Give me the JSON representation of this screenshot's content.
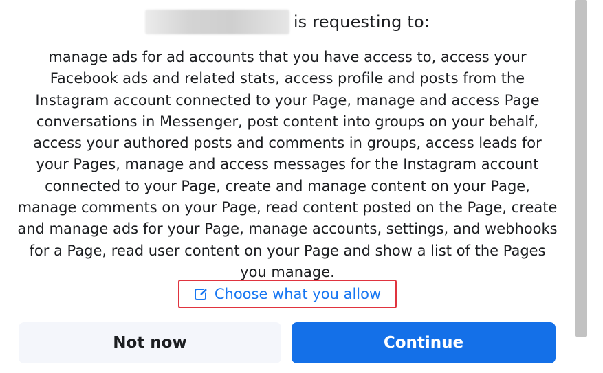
{
  "dialog": {
    "app_name": "",
    "header_text": "is requesting to:",
    "permissions_text": "manage ads for ad accounts that you have access to, access your Facebook ads and related stats, access profile and posts from the Instagram account connected to your Page, manage and access Page conversations in Messenger, post content into groups on your behalf, access your authored posts and comments in groups, access leads for your Pages, manage and access messages for the Instagram account connected to your Page, create and manage content on your Page, manage comments on your Page, read content posted on the Page, create and manage ads for your Page, manage accounts, settings, and webhooks for a Page, read user content on your Page and show a list of the Pages you manage.",
    "choose_link": {
      "label": "Choose what you allow",
      "icon": "edit-icon",
      "highlight_color": "#e0343f"
    },
    "buttons": {
      "not_now": "Not now",
      "continue": "Continue"
    }
  },
  "colors": {
    "link": "#1877f2",
    "primary": "#1470e8",
    "secondary_bg": "#f4f6fb"
  }
}
